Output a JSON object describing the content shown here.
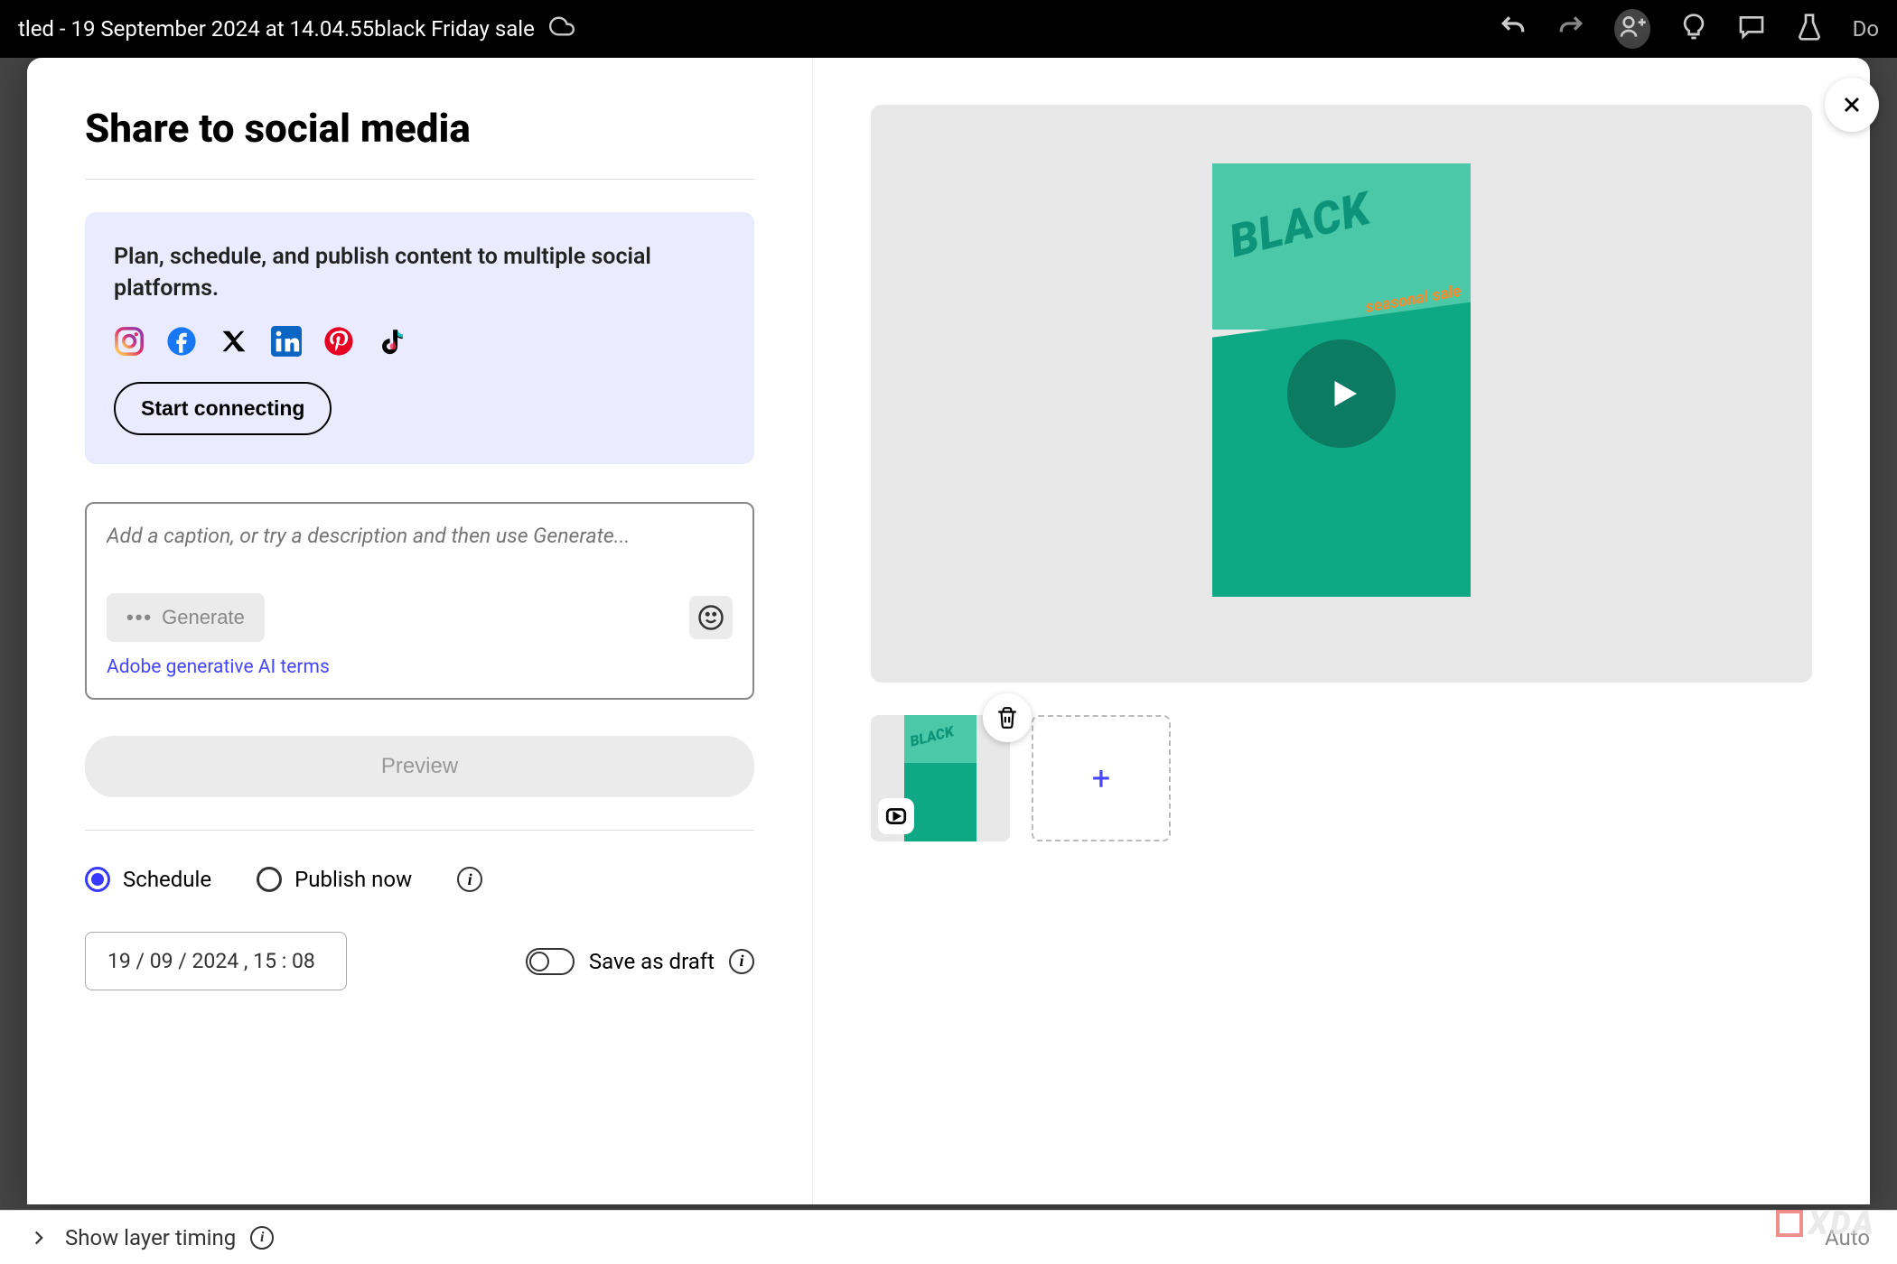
{
  "top_bar": {
    "title": "tled - 19 September 2024 at 14.04.55black Friday sale",
    "download_partial": "Do"
  },
  "modal": {
    "title": "Share to social media",
    "connect": {
      "description": "Plan, schedule, and publish content to multiple social platforms.",
      "button": "Start connecting"
    },
    "caption": {
      "placeholder": "Add a caption, or try a description and then use Generate...",
      "generate_label": "Generate",
      "ai_terms": "Adobe generative AI terms"
    },
    "preview_button": "Preview",
    "radio": {
      "schedule": "Schedule",
      "publish_now": "Publish now",
      "selected": "schedule"
    },
    "schedule_datetime": "19 / 09 / 2024 , 15 : 08",
    "save_draft": "Save as draft",
    "video": {
      "title_text": "BLACK",
      "subtitle_text": "seasonal sale"
    }
  },
  "bottom_bar": {
    "show_layer_timing": "Show layer timing",
    "auto_label": "Auto"
  },
  "watermark": "XDA"
}
